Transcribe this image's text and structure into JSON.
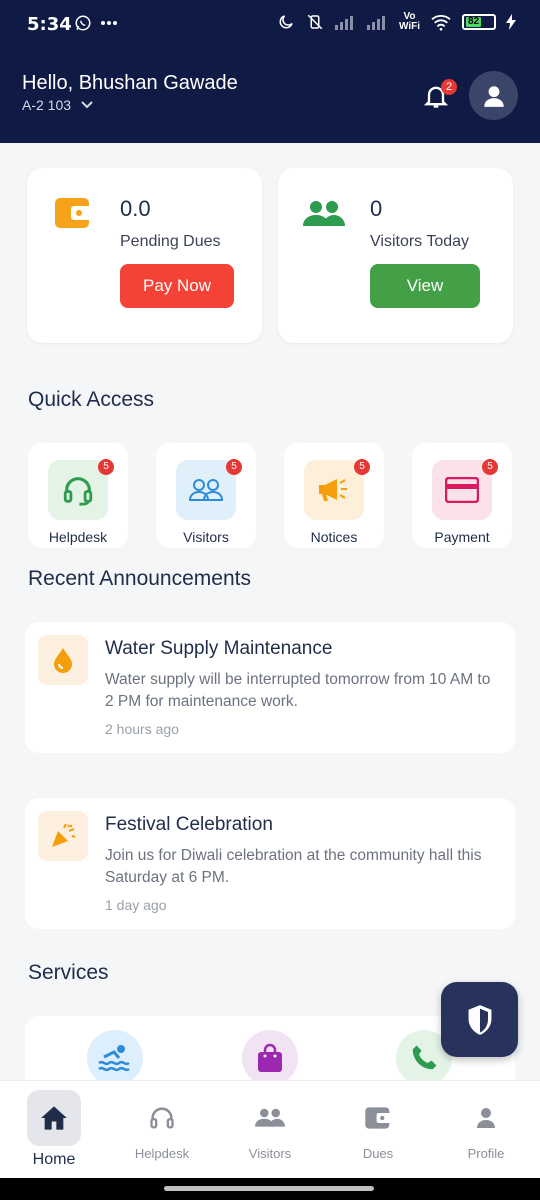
{
  "status_bar": {
    "time": "5:34",
    "battery": "82",
    "vowifi_line1": "Vo",
    "vowifi_line2": "WiFi"
  },
  "header": {
    "greeting": "Hello, Bhushan Gawade",
    "unit": "A-2 103",
    "notification_count": "2"
  },
  "stats": {
    "dues": {
      "value": "0.0",
      "label": "Pending Dues",
      "button": "Pay Now"
    },
    "visitors": {
      "value": "0",
      "label": "Visitors Today",
      "button": "View"
    }
  },
  "quick_access": {
    "title": "Quick Access",
    "items": [
      {
        "label": "Helpdesk",
        "badge": "5",
        "icon": "headset-icon"
      },
      {
        "label": "Visitors",
        "badge": "5",
        "icon": "people-icon"
      },
      {
        "label": "Notices",
        "badge": "5",
        "icon": "megaphone-icon"
      },
      {
        "label": "Payment",
        "badge": "5",
        "icon": "card-icon"
      }
    ]
  },
  "announcements": {
    "title": "Recent Announcements",
    "items": [
      {
        "title": "Water Supply Maintenance",
        "body": "Water supply will be interrupted tomorrow from 10 AM to 2 PM for maintenance work.",
        "time": "2 hours ago",
        "icon": "water-drop-icon"
      },
      {
        "title": "Festival Celebration",
        "body": "Join us for Diwali celebration at the community hall this Saturday at 6 PM.",
        "time": "1 day ago",
        "icon": "party-popper-icon"
      }
    ]
  },
  "services": {
    "title": "Services",
    "icons": [
      "pool-icon",
      "shopping-bag-icon",
      "phone-icon"
    ]
  },
  "bottom_nav": {
    "items": [
      {
        "label": "Home",
        "icon": "home-icon"
      },
      {
        "label": "Helpdesk",
        "icon": "headset-icon"
      },
      {
        "label": "Visitors",
        "icon": "people-icon"
      },
      {
        "label": "Dues",
        "icon": "wallet-icon"
      },
      {
        "label": "Profile",
        "icon": "person-icon"
      }
    ]
  },
  "colors": {
    "header": "#0f1a45",
    "pay": "#f44336",
    "view": "#43a047",
    "accent_orange": "#f59e0b"
  }
}
